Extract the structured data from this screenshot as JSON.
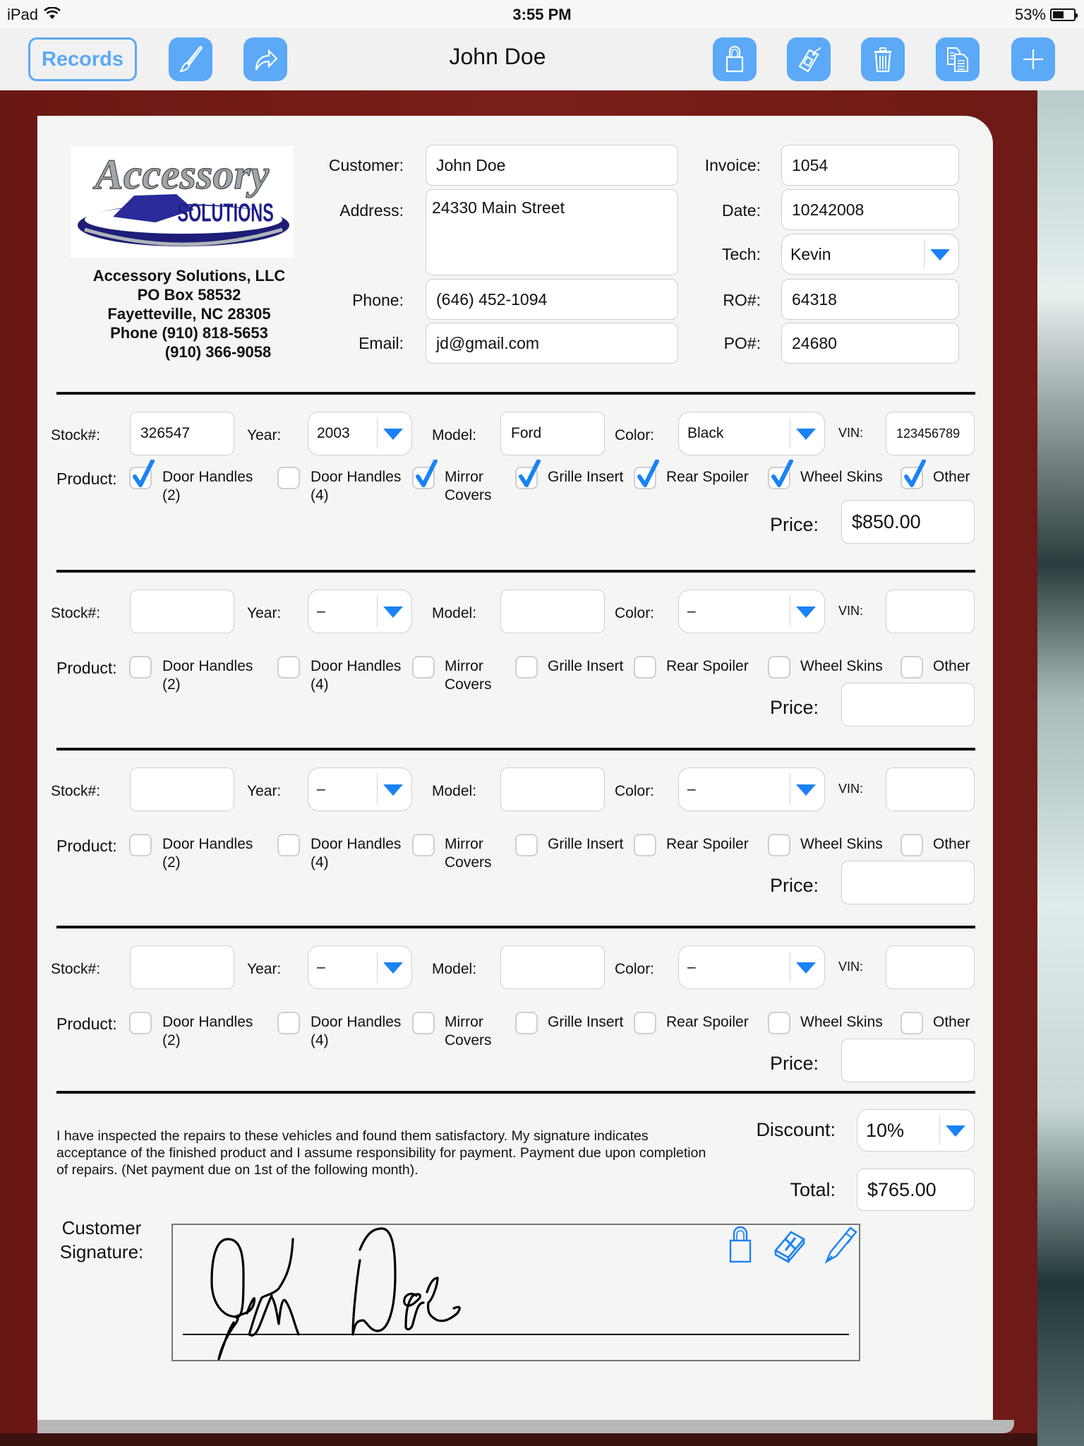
{
  "status_bar": {
    "device": "iPad",
    "time": "3:55 PM",
    "battery_percent": "53%",
    "battery_level": 0.53
  },
  "toolbar": {
    "records_label": "Records",
    "title": "John Doe",
    "icons": [
      "paintbrush-icon",
      "share-icon",
      "lock-icon",
      "tag-icon",
      "trash-icon",
      "copy-icon",
      "plus-icon"
    ]
  },
  "company": {
    "logo_text_top": "Accessory",
    "logo_text_bottom": "SOLUTIONS",
    "name": "Accessory Solutions, LLC",
    "po_box": "PO Box 58532",
    "city": "Fayetteville, NC  28305",
    "phone1": "Phone  (910) 818-5653",
    "phone2": "(910) 366-9058"
  },
  "customer": {
    "customer_label": "Customer:",
    "customer_value": "John Doe",
    "address_label": "Address:",
    "address_value": "24330 Main Street",
    "phone_label": "Phone:",
    "phone_value": "(646) 452-1094",
    "email_label": "Email:",
    "email_value": "jd@gmail.com"
  },
  "invoice": {
    "invoice_label": "Invoice:",
    "invoice_value": "1054",
    "date_label": "Date:",
    "date_value": "10242008",
    "tech_label": "Tech:",
    "tech_value": "Kevin",
    "ro_label": "RO#:",
    "ro_value": "64318",
    "po_label": "PO#:",
    "po_value": "24680"
  },
  "labels": {
    "stock": "Stock#:",
    "year": "Year:",
    "model": "Model:",
    "color": "Color:",
    "vin": "VIN:",
    "product": "Product:",
    "price": "Price:"
  },
  "product_options": [
    {
      "line1": "Door Handles",
      "line2": "(2)"
    },
    {
      "line1": "Door Handles",
      "line2": "(4)"
    },
    {
      "line1": "Mirror",
      "line2": "Covers"
    },
    {
      "line1": "Grille Insert",
      "line2": ""
    },
    {
      "line1": "Rear Spoiler",
      "line2": ""
    },
    {
      "line1": "Wheel Skins",
      "line2": ""
    },
    {
      "line1": "Other",
      "line2": ""
    }
  ],
  "vehicles": [
    {
      "stock": "326547",
      "year": "2003",
      "model": "Ford",
      "color": "Black",
      "vin": "123456789",
      "price": "$850.00",
      "checked": [
        true,
        false,
        true,
        true,
        true,
        true,
        true
      ]
    },
    {
      "stock": "",
      "year": "–",
      "model": "",
      "color": "–",
      "vin": "",
      "price": "",
      "checked": [
        false,
        false,
        false,
        false,
        false,
        false,
        false
      ]
    },
    {
      "stock": "",
      "year": "–",
      "model": "",
      "color": "–",
      "vin": "",
      "price": "",
      "checked": [
        false,
        false,
        false,
        false,
        false,
        false,
        false
      ]
    },
    {
      "stock": "",
      "year": "–",
      "model": "",
      "color": "–",
      "vin": "",
      "price": "",
      "checked": [
        false,
        false,
        false,
        false,
        false,
        false,
        false
      ]
    }
  ],
  "footer": {
    "disclaimer": "I have inspected the repairs to these vehicles and found them satisfactory. My signature indicates acceptance of the finished product and I assume responsibility for payment. Payment due upon completion of repairs. (Net payment due on 1st of the following month).",
    "discount_label": "Discount:",
    "discount_value": "10%",
    "total_label": "Total:",
    "total_value": "$765.00",
    "signature_label_1": "Customer",
    "signature_label_2": "Signature:",
    "signature_text": "John Doe"
  },
  "colors": {
    "accent": "#5ba9f7",
    "dropdown_arrow": "#1a82f5",
    "checkmark": "#1a82f5",
    "background_wood": "#6b1a17"
  }
}
